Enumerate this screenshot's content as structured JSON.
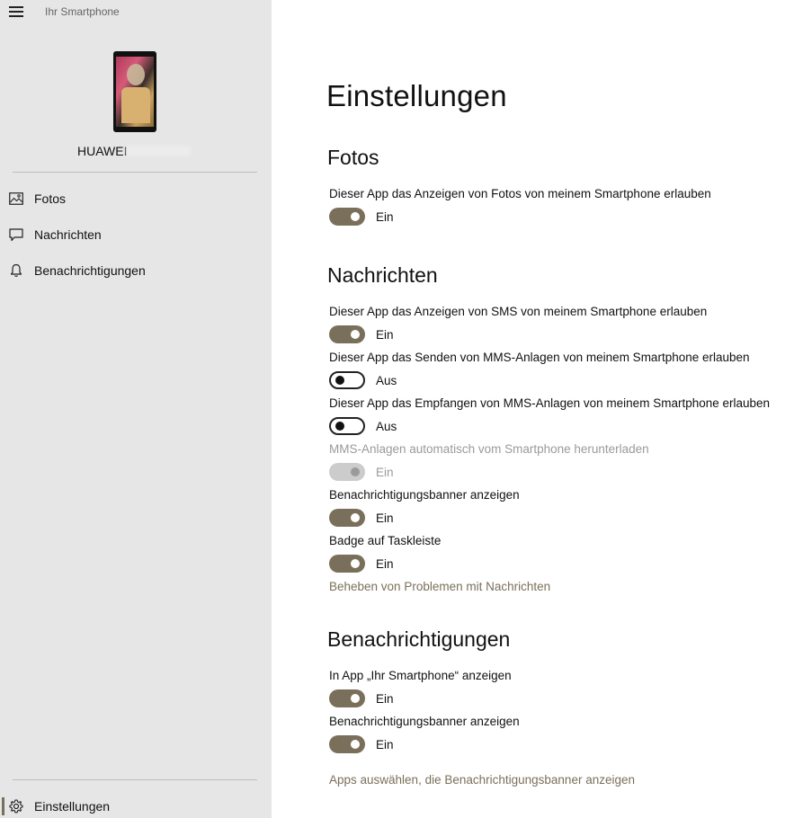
{
  "app": {
    "title": "Ihr Smartphone"
  },
  "device": {
    "name": "HUAWEI"
  },
  "nav": {
    "items": [
      {
        "label": "Fotos",
        "icon": "photo-icon"
      },
      {
        "label": "Nachrichten",
        "icon": "message-icon"
      },
      {
        "label": "Benachrichtigungen",
        "icon": "bell-icon"
      }
    ],
    "settings": {
      "label": "Einstellungen",
      "icon": "gear-icon"
    }
  },
  "main": {
    "title": "Einstellungen",
    "fotos": {
      "title": "Fotos",
      "settings": [
        {
          "label": "Dieser App das Anzeigen von Fotos von meinem Smartphone erlauben",
          "state": "Ein"
        }
      ]
    },
    "nachrichten": {
      "title": "Nachrichten",
      "settings": [
        {
          "label": "Dieser App das Anzeigen von SMS von meinem Smartphone erlauben",
          "state": "Ein"
        },
        {
          "label": "Dieser App das Senden von MMS-Anlagen von meinem Smartphone erlauben",
          "state": "Aus"
        },
        {
          "label": "Dieser App das Empfangen von MMS-Anlagen von meinem Smartphone erlauben",
          "state": "Aus"
        },
        {
          "label": "MMS-Anlagen automatisch vom Smartphone herunterladen",
          "state": "Ein"
        },
        {
          "label": "Benachrichtigungsbanner anzeigen",
          "state": "Ein"
        },
        {
          "label": "Badge auf Taskleiste",
          "state": "Ein"
        }
      ],
      "link": "Beheben von Problemen mit Nachrichten"
    },
    "benachrichtigungen": {
      "title": "Benachrichtigungen",
      "settings": [
        {
          "label": "In App „Ihr Smartphone“ anzeigen",
          "state": "Ein"
        },
        {
          "label": "Benachrichtigungsbanner anzeigen",
          "state": "Ein"
        }
      ],
      "link": "Apps auswählen, die Benachrichtigungsbanner anzeigen"
    }
  },
  "colors": {
    "accent": "#7a6f5a",
    "sidebar_bg": "#e6e6e6",
    "disabled": "#9a9a9a"
  }
}
